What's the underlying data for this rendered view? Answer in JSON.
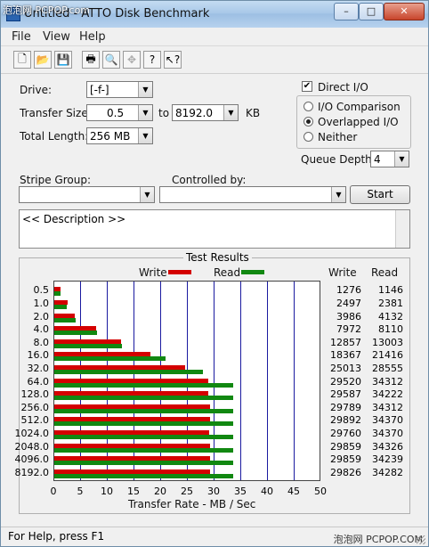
{
  "window": {
    "title": "Untitled - ATTO Disk Benchmark",
    "watermark_top": "泡泡网 PCPOP.com",
    "min_btn": "–",
    "max_btn": "□",
    "close_btn": "✕"
  },
  "menu": [
    "File",
    "View",
    "Help"
  ],
  "toolbar": {
    "new": "🗋",
    "open": "📂",
    "save": "💾",
    "print": "🖶",
    "preview": "🔍",
    "move": "✥",
    "help": "?",
    "context_help": "↖?"
  },
  "settings": {
    "drive_label": "Drive:",
    "drive_value": "[-f-]",
    "transfer_size_label": "Transfer Size:",
    "transfer_from": "0.5",
    "to_label": "to",
    "transfer_to": "8192.0",
    "kb_label": "KB",
    "total_length_label": "Total Length:",
    "total_length_value": "256 MB",
    "direct_io_label": "Direct I/O",
    "direct_io_checked": "✔",
    "io_comparison_label": "I/O Comparison",
    "overlapped_io_label": "Overlapped I/O",
    "neither_label": "Neither",
    "queue_depth_label": "Queue Depth:",
    "queue_depth_value": "4",
    "stripe_group_label": "Stripe Group:",
    "controlled_by_label": "Controlled by:",
    "start_label": "Start",
    "description": "<< Description >>"
  },
  "results": {
    "title": "Test Results",
    "write_legend": "Write",
    "read_legend": "Read",
    "write_col": "Write",
    "read_col": "Read",
    "xaxis_title": "Transfer Rate - MB / Sec"
  },
  "chart_data": {
    "type": "bar",
    "orientation": "horizontal",
    "categories": [
      "0.5",
      "1.0",
      "2.0",
      "4.0",
      "8.0",
      "16.0",
      "32.0",
      "64.0",
      "128.0",
      "256.0",
      "512.0",
      "1024.0",
      "2048.0",
      "4096.0",
      "8192.0"
    ],
    "series": [
      {
        "name": "Write",
        "color": "#d40000",
        "values": [
          1276,
          2497,
          3986,
          7972,
          12857,
          18367,
          25013,
          29520,
          29587,
          29789,
          29892,
          29760,
          29859,
          29859,
          29826
        ]
      },
      {
        "name": "Read",
        "color": "#118811",
        "values": [
          1146,
          2381,
          4132,
          8110,
          13003,
          21416,
          28555,
          34312,
          34222,
          34312,
          34370,
          34370,
          34326,
          34239,
          34282
        ]
      }
    ],
    "xlabel": "Transfer Rate - MB / Sec",
    "xticks": [
      0,
      5,
      10,
      15,
      20,
      25,
      30,
      35,
      40,
      45,
      50
    ],
    "xlim": [
      0,
      50
    ]
  },
  "status": {
    "text": "For Help, press F1",
    "watermark": "泡泡网 PCPOP.COM"
  }
}
